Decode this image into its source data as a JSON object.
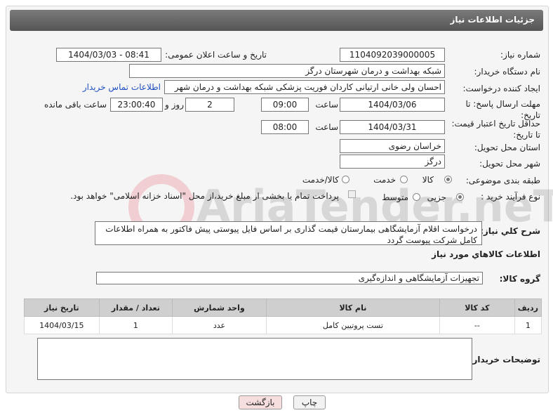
{
  "header": {
    "title": "جزئیات اطلاعات نیاز"
  },
  "fields": {
    "need_number_label": "شماره نیاز:",
    "need_number": "1104092039000005",
    "announce_label": "تاریخ و ساعت اعلان عمومی:",
    "announce_value": "1404/03/03 - 08:41",
    "buyer_org_label": "نام دستگاه خریدار:",
    "buyer_org": "شبکه بهداشت و درمان شهرستان درگز",
    "creator_label": "ایجاد کننده درخواست:",
    "creator": "احسان ولی خانی ارتیانی کاردان  فوریت  پزشکی  شبکه بهداشت و درمان شهر",
    "contact_link": "اطلاعات تماس خریدار",
    "deadline_label": "مهلت ارسال پاسخ: تا تاریخ:",
    "deadline_date": "1404/03/06",
    "time_label": "ساعت",
    "deadline_time": "09:00",
    "days_value": "2",
    "days_label": "روز و",
    "remaining_value": "23:00:40",
    "remaining_label": "ساعت باقی مانده",
    "validity_label": "حداقل تاریخ اعتبار قیمت: تا تاریخ:",
    "validity_date": "1404/03/31",
    "validity_time": "08:00",
    "province_label": "استان محل تحویل:",
    "province": "خراسان رضوی",
    "city_label": "شهر محل تحویل:",
    "city": "درگز",
    "category_label": "طبقه بندی موضوعی:",
    "category_options": [
      "کالا",
      "خدمت",
      "کالا/خدمت"
    ],
    "process_label": "نوع فرآیند خرید :",
    "process_options": [
      "جزیی",
      "متوسط"
    ],
    "payment_note": "پرداخت تمام یا بخشی از مبلغ خرید،از محل \"اسناد خزانه اسلامی\" خواهد بود."
  },
  "description": {
    "label": "شرح کلي نياز:",
    "text": "درخواست اقلام آزمایشگاهی بیمارستان قیمت گذاری بر اساس فایل پیوستی پیش فاکتور به همراه اطلاعات کامل شرکت پیوست گردد"
  },
  "goods": {
    "section_title": "اطلاعات کالاهاي مورد نياز",
    "group_label": "گروه کالا:",
    "group_value": "تجهیزات آزمایشگاهی و اندازه‌گیری",
    "columns": [
      "رديف",
      "کد کالا",
      "نام کالا",
      "واحد شمارش",
      "تعداد / مقدار",
      "تاريخ نياز"
    ],
    "rows": [
      [
        "1",
        "--",
        "تست پروتیین کامل",
        "عدد",
        "1",
        "1404/03/15"
      ]
    ]
  },
  "buyer_notes": {
    "label": "توضیحات خریدار:",
    "text": ""
  },
  "buttons": {
    "print": "چاپ",
    "back": "بازگشت"
  },
  "watermark": {
    "text": "AriaTender.neT"
  },
  "colors": {
    "title_bar": "#666666",
    "link": "#1f4fbf",
    "back_button": "#f7dede"
  }
}
